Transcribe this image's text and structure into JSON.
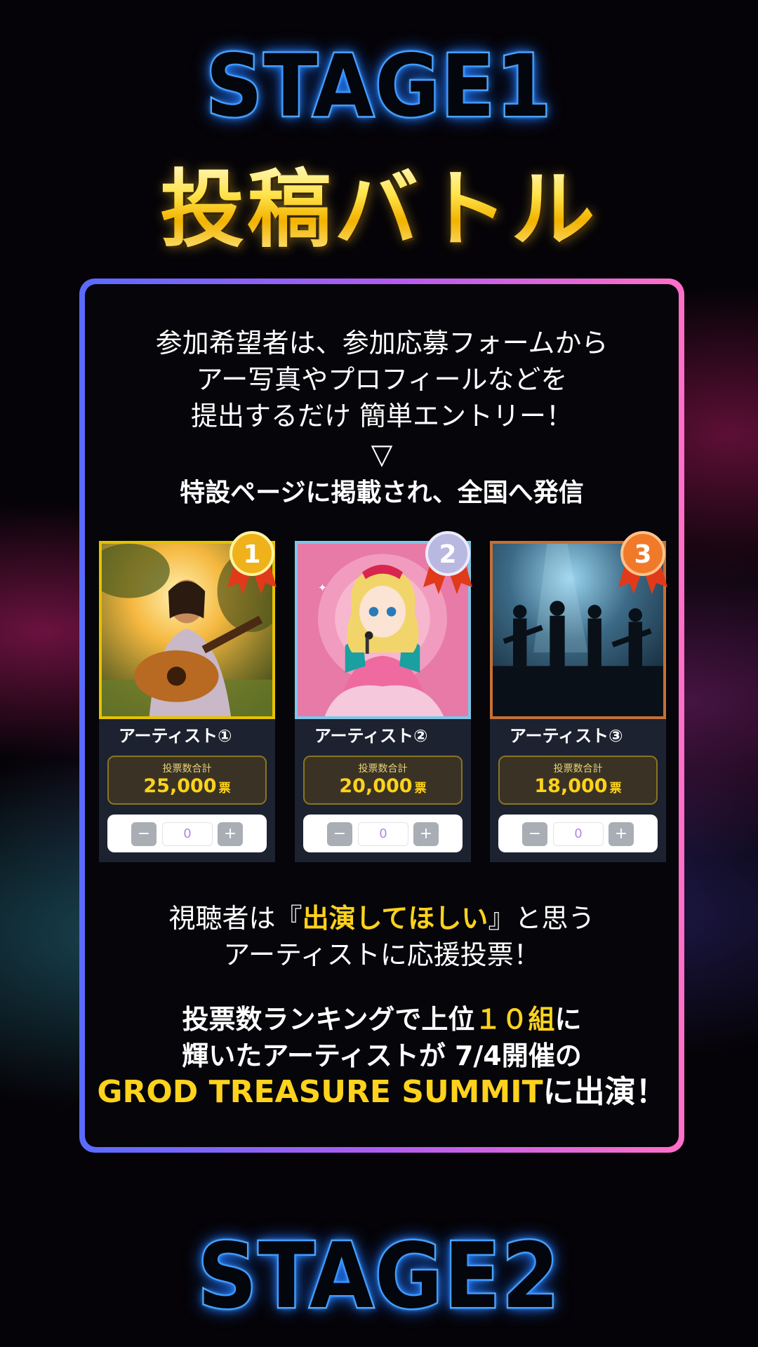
{
  "stage1": {
    "title": "STAGE1"
  },
  "battle": {
    "title": "投稿バトル"
  },
  "intro": {
    "line1": "参加希望者は、参加応募フォームから",
    "line2": "アー写真やプロフィールなどを",
    "line3": "提出するだけ 簡単エントリー！",
    "arrow": "▽",
    "headline": "特設ページに掲載され、全国へ発信"
  },
  "cards": [
    {
      "rank": "1",
      "name": "アーティスト①",
      "votes_label": "投票数合計",
      "votes": "25,000",
      "unit": "票",
      "vote_input": "0",
      "minus": "−",
      "plus": "+",
      "medal_color": "#f0b21a"
    },
    {
      "rank": "2",
      "name": "アーティスト②",
      "votes_label": "投票数合計",
      "votes": "20,000",
      "unit": "票",
      "vote_input": "0",
      "minus": "−",
      "plus": "+",
      "medal_color": "#b9b8e0"
    },
    {
      "rank": "3",
      "name": "アーティスト③",
      "votes_label": "投票数合計",
      "votes": "18,000",
      "unit": "票",
      "vote_input": "0",
      "minus": "−",
      "plus": "+",
      "medal_color": "#f07a2a"
    }
  ],
  "viewer": {
    "line1_pre": "視聴者は『",
    "line1_hl": "出演してほしい",
    "line1_post": "』と思う",
    "line2": "アーティストに応援投票！"
  },
  "ranking": {
    "line1_pre": "投票数ランキングで上位",
    "line1_hl": "１０組",
    "line1_post": "に",
    "line2": "輝いたアーティストが 7/4開催の",
    "line3_hl": "GROD TREASURE SUMMIT",
    "line3_post": "に出演！"
  },
  "stage2": {
    "title": "STAGE2"
  },
  "colors": {
    "neon_blue": "#6fc4ff",
    "gold": "#ffd21c",
    "frame_start": "#5a6bff",
    "frame_end": "#ff6fc8"
  }
}
